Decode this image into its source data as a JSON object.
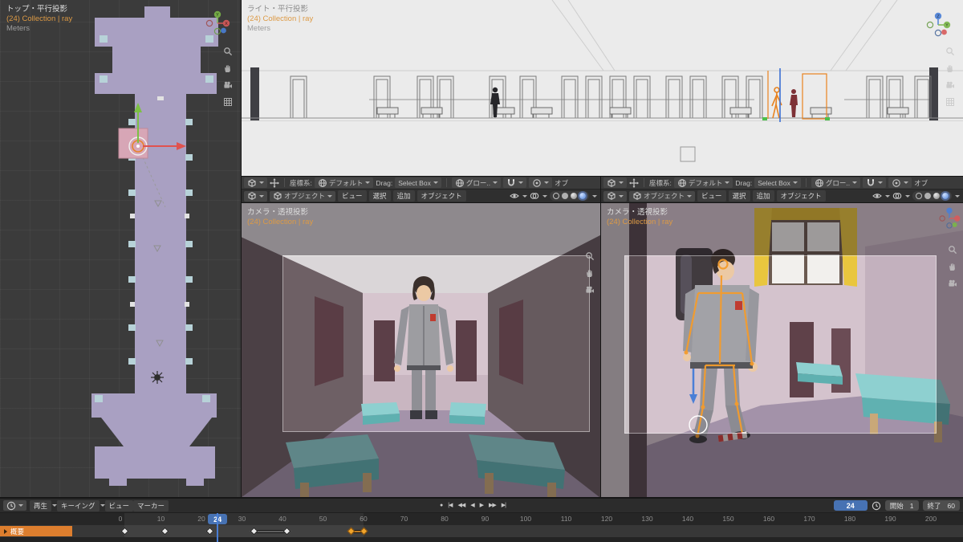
{
  "ui_colors": {
    "accent_orange": "#dd7e2e",
    "accent_blue": "#4772b3",
    "keyframe_selected": "#f0a42b"
  },
  "viewports": {
    "top": {
      "view": "トップ・平行投影",
      "collection": "(24) Collection | ray",
      "units": "Meters"
    },
    "right_ortho": {
      "view": "ライト・平行投影",
      "collection": "(24) Collection | ray",
      "units": "Meters"
    },
    "cam_left": {
      "view": "カメラ・透視投影",
      "collection": "(24) Collection | ray"
    },
    "cam_right": {
      "view": "カメラ・透視投影",
      "collection": "(24) Collection | ray"
    }
  },
  "tool_settings": {
    "coord_label": "座標系:",
    "coord_value": "デフォルト",
    "drag_label": "Drag:",
    "drag_value": "Select Box",
    "orientation_value": "グロー..",
    "trailing_truncated": "オブ"
  },
  "viewport_header": {
    "mode": "オブジェクト",
    "menus": [
      "ビュー",
      "選択",
      "追加",
      "オブジェクト"
    ]
  },
  "timeline": {
    "menus": [
      "再生",
      "キーイング",
      "ビュー",
      "マーカー"
    ],
    "transport": [
      {
        "name": "autokey",
        "glyph": "●"
      },
      {
        "name": "jump-start",
        "glyph": "|◀"
      },
      {
        "name": "prev-keyframe",
        "glyph": "◀◀"
      },
      {
        "name": "play-reverse",
        "glyph": "◀"
      },
      {
        "name": "play",
        "glyph": "▶"
      },
      {
        "name": "next-keyframe",
        "glyph": "▶▶"
      },
      {
        "name": "jump-end",
        "glyph": "▶|"
      }
    ],
    "current_frame": 24,
    "start_label": "開始",
    "start_value": 1,
    "end_label": "終了",
    "end_value": 60,
    "ruler_ticks": [
      0,
      10,
      20,
      30,
      40,
      50,
      60,
      70,
      80,
      90,
      100,
      110,
      120,
      130,
      140,
      150,
      160,
      170,
      180,
      190,
      200
    ],
    "channel": {
      "label": "概要"
    },
    "keyframes": [
      {
        "frame": 1,
        "selected": false
      },
      {
        "frame": 11,
        "selected": false
      },
      {
        "frame": 22,
        "selected": false
      },
      {
        "frame": 33,
        "selected": false
      },
      {
        "frame": 41,
        "selected": false
      },
      {
        "frame": 57,
        "selected": true
      },
      {
        "frame": 60,
        "selected": true
      }
    ],
    "holds": [
      {
        "from": 33,
        "to": 41,
        "selected": false
      },
      {
        "from": 57,
        "to": 60,
        "selected": true
      }
    ]
  }
}
